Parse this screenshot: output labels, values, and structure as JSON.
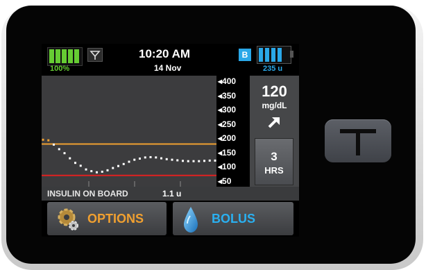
{
  "status": {
    "time": "10:20 AM",
    "date": "14 Nov",
    "battery_percent_label": "100%",
    "battery_level": 1.0,
    "bluetooth_badge": "B",
    "insulin_remaining": "235 u",
    "insulin_level": 0.8,
    "signal_icon": "antenna-icon"
  },
  "cgm": {
    "value": "120",
    "unit": "mg/dL",
    "trend_icon": "arrow-up-right-icon",
    "timeframe_number": "3",
    "timeframe_unit": "HRS",
    "scale_labels": [
      "400",
      "350",
      "300",
      "250",
      "200",
      "150",
      "100",
      "50"
    ],
    "high_threshold": 180,
    "low_threshold": 70,
    "readings": [
      195,
      193,
      178,
      162,
      148,
      130,
      114,
      104,
      91,
      85,
      81,
      83,
      88,
      96,
      103,
      110,
      118,
      125,
      129,
      133,
      134,
      133,
      130,
      127,
      125,
      123,
      121,
      120,
      120,
      120,
      121,
      122,
      122
    ]
  },
  "iob": {
    "label": "INSULIN ON BOARD",
    "value": "1.1 u"
  },
  "buttons": {
    "options_label": "OPTIONS",
    "bolus_label": "BOLUS"
  },
  "colors": {
    "battery_green": "#66cc33",
    "insulin_blue": "#2aa8e8",
    "high_line": "#f0a030",
    "low_line": "#e02020",
    "options_text": "#f0a030",
    "bolus_text": "#2ab0f0"
  }
}
